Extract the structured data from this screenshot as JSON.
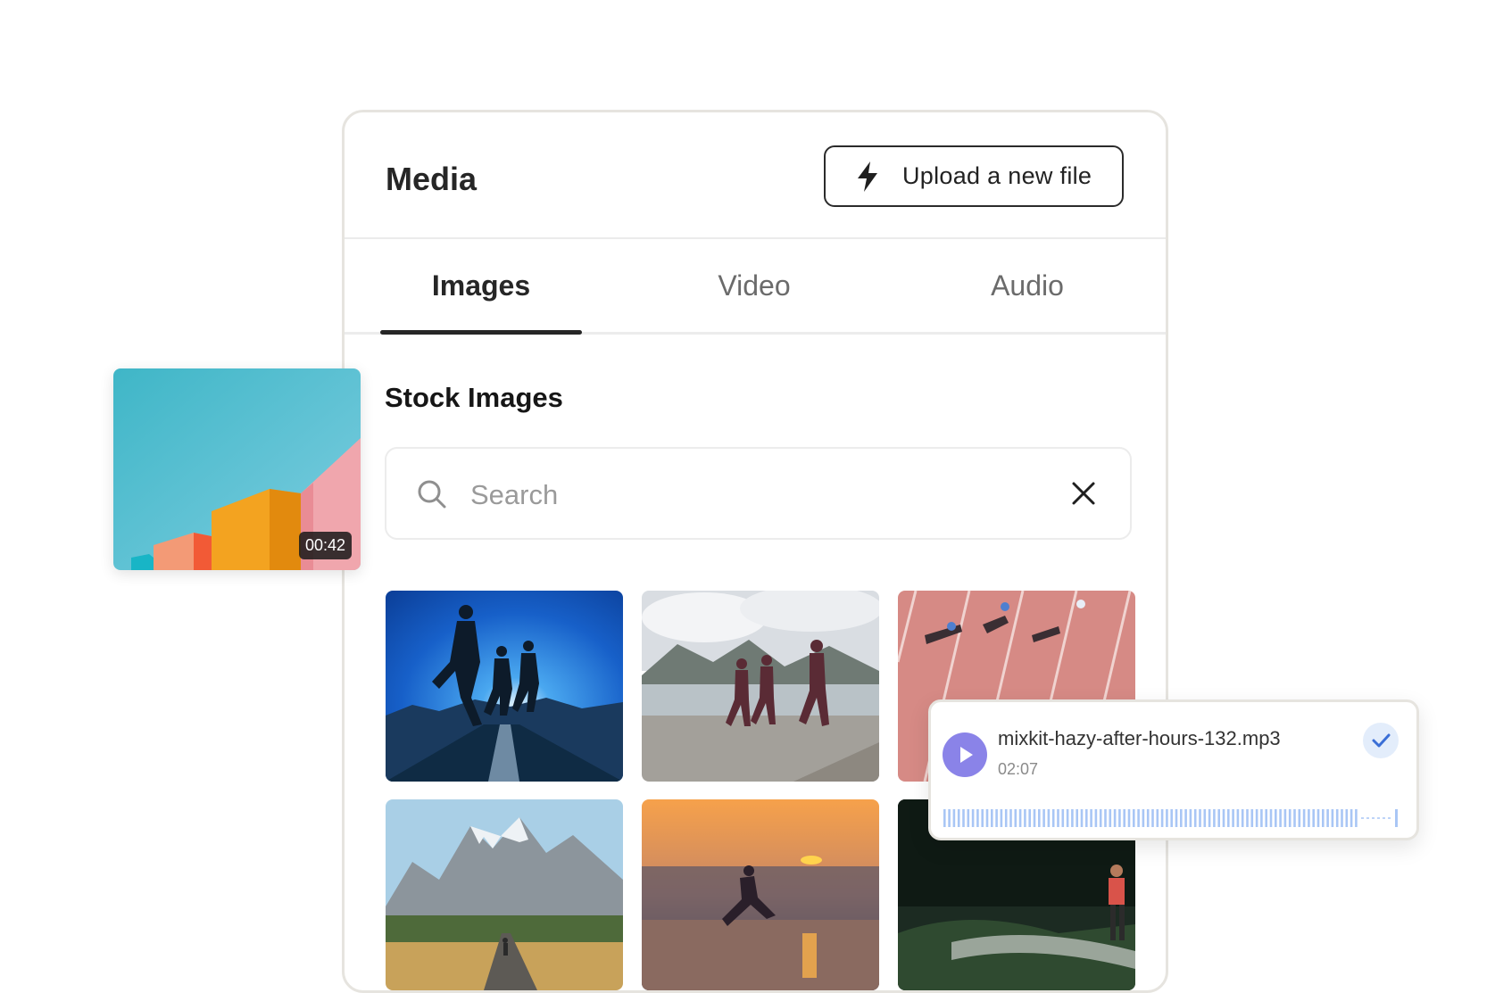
{
  "panel": {
    "title": "Media",
    "upload_label": "Upload a new file"
  },
  "tabs": [
    {
      "label": "Images",
      "active": true
    },
    {
      "label": "Video",
      "active": false
    },
    {
      "label": "Audio",
      "active": false
    }
  ],
  "section_title": "Stock Images",
  "search": {
    "placeholder": "Search",
    "value": ""
  },
  "video_thumb": {
    "duration": "00:42"
  },
  "audio_item": {
    "filename": "mixkit-hazy-after-hours-132.mp3",
    "duration": "02:07",
    "selected": true
  },
  "colors": {
    "accent_purple": "#8a83e8",
    "check_blue": "#3b6fd6",
    "waveform_blue": "#a9c6f5",
    "border": "#e6e4df"
  },
  "icons": [
    "bolt-icon",
    "search-icon",
    "close-icon",
    "play-icon",
    "check-icon"
  ]
}
